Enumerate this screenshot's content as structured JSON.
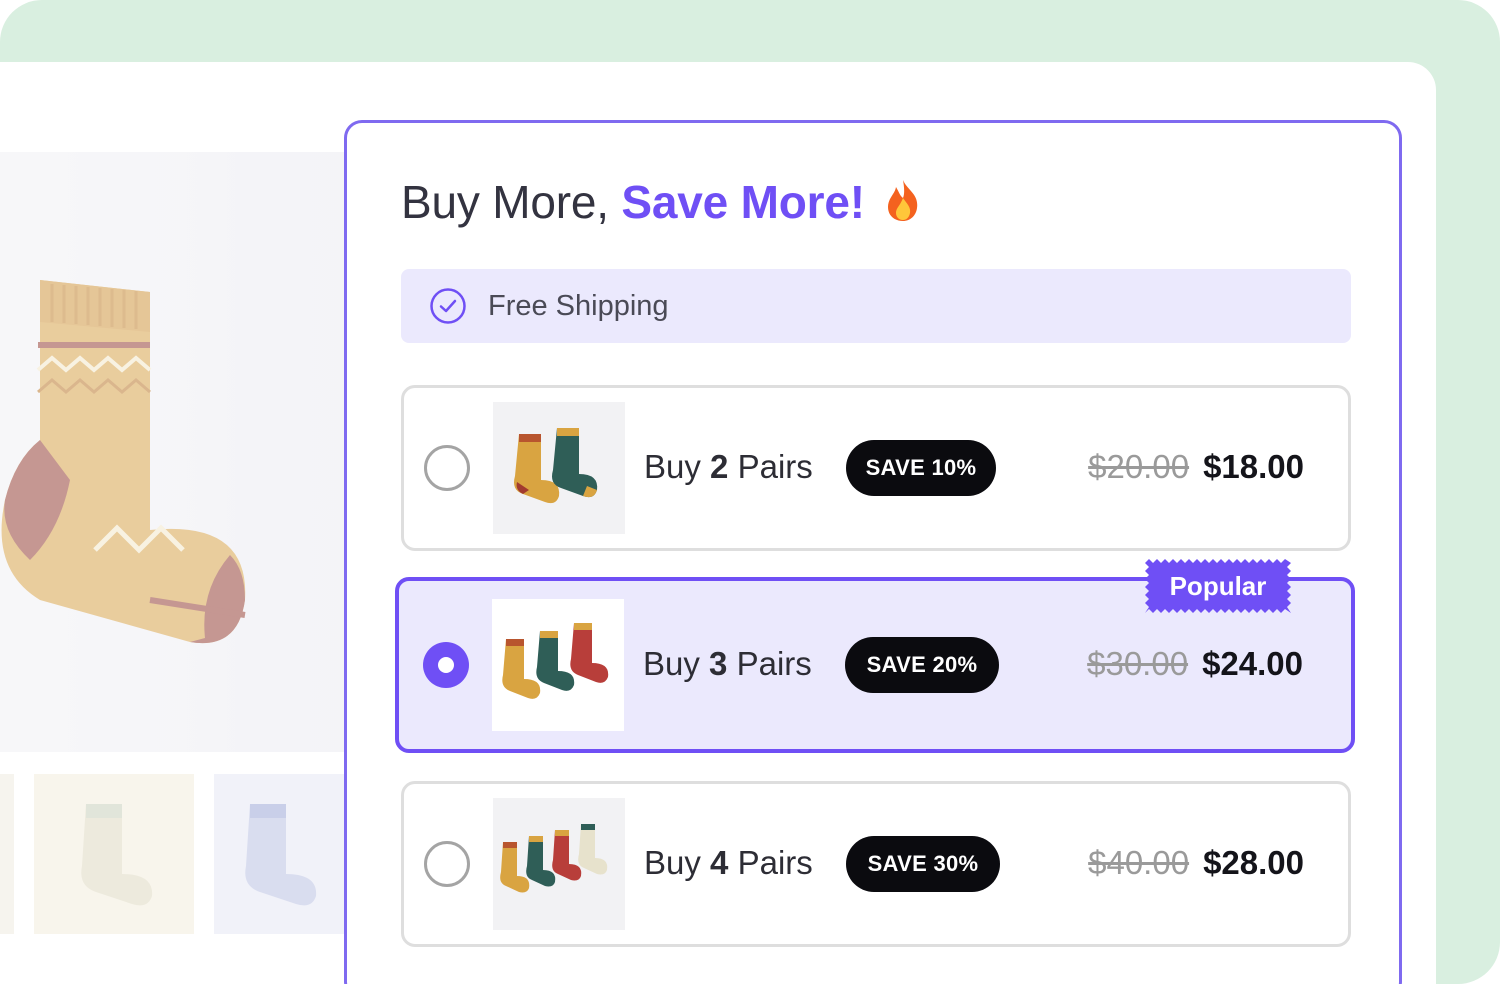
{
  "widget": {
    "heading_plain": "Buy More, ",
    "heading_accent": "Save More!",
    "heading_emoji_icon": "fire-icon",
    "shipping_label": "Free Shipping",
    "shipping_icon": "check-circle-icon"
  },
  "options": [
    {
      "prefix": "Buy ",
      "qty": "2",
      "suffix": " Pairs",
      "save": "SAVE 10%",
      "old_price": "$20.00",
      "new_price": "$18.00",
      "selected": false
    },
    {
      "prefix": "Buy ",
      "qty": "3",
      "suffix": " Pairs",
      "save": "SAVE 20%",
      "old_price": "$30.00",
      "new_price": "$24.00",
      "selected": true,
      "badge": "Popular"
    },
    {
      "prefix": "Buy ",
      "qty": "4",
      "suffix": " Pairs",
      "save": "SAVE 30%",
      "old_price": "$40.00",
      "new_price": "$28.00",
      "selected": false
    }
  ],
  "colors": {
    "accent": "#6f4ff5",
    "frame_green": "#d9efe0",
    "shipping_bg": "#ebe9fd"
  }
}
